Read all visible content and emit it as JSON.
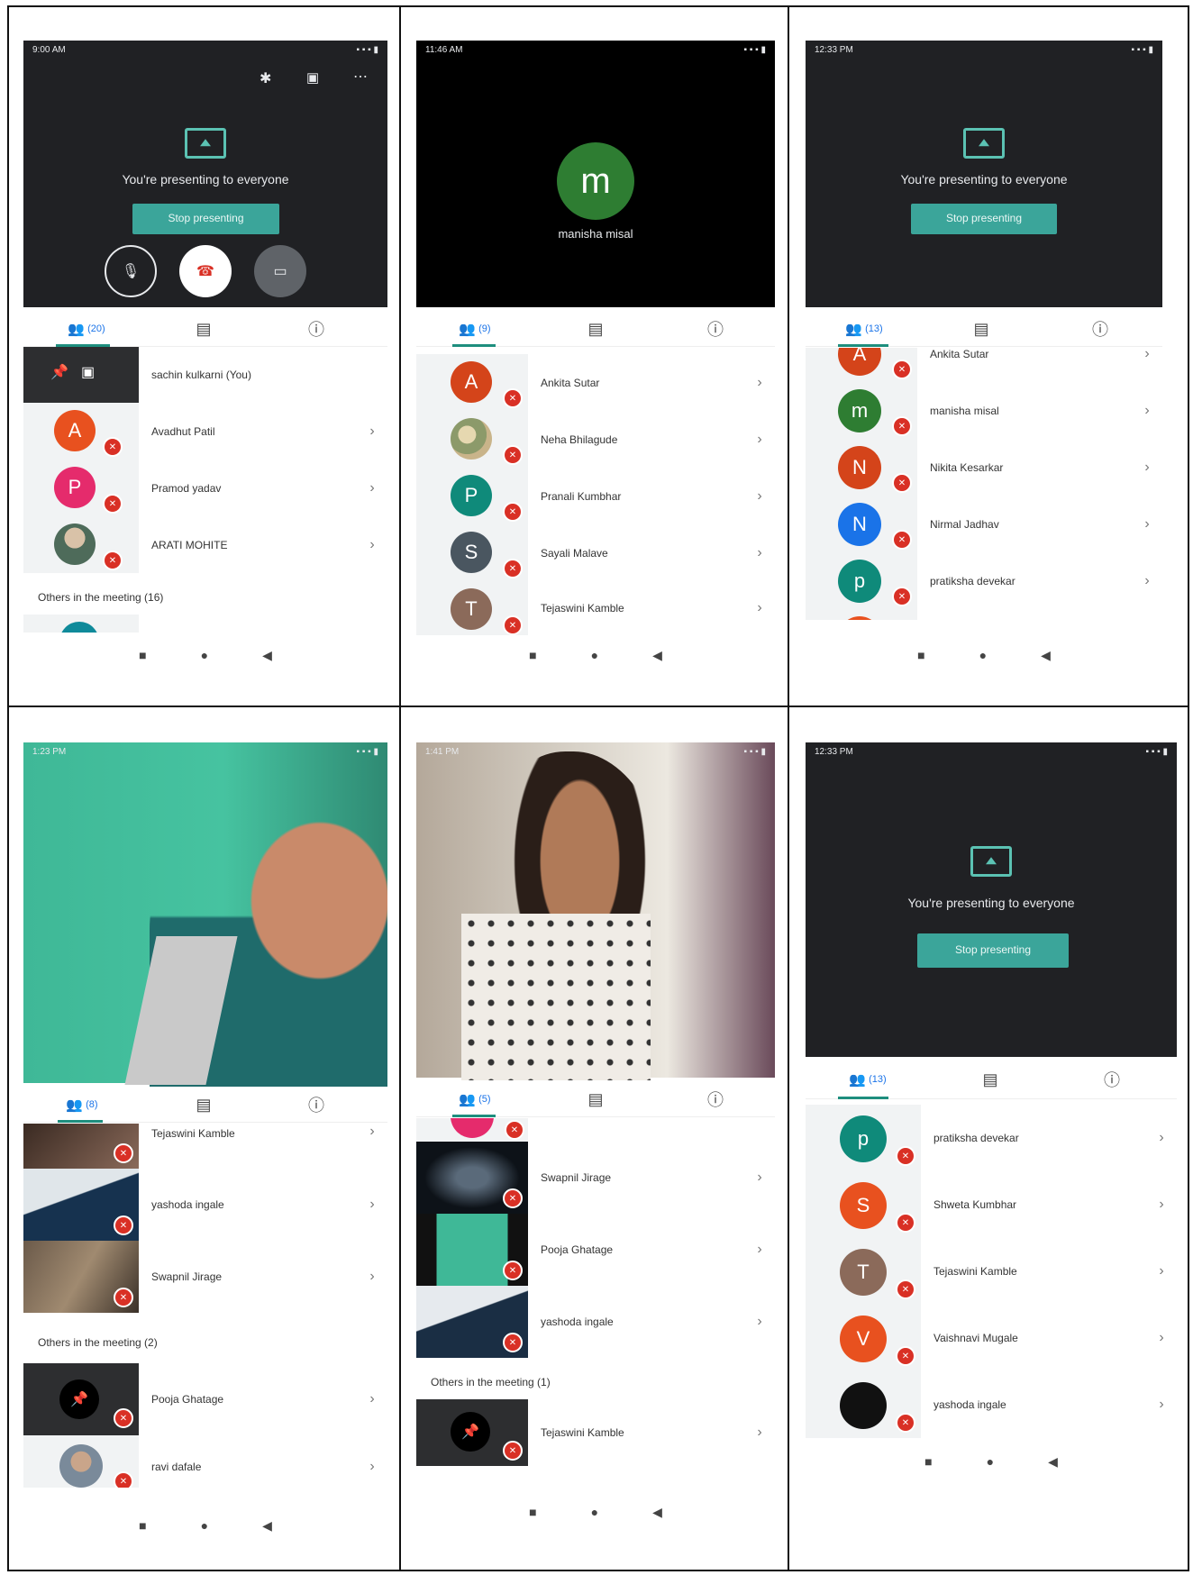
{
  "colors": {
    "teal": "#3ba59a",
    "dark_bg": "#202124",
    "mute_red": "#d93025",
    "tab_blue": "#1a73e8"
  },
  "panel1": {
    "time": "9:00 AM",
    "top_icons": [
      "bluetooth-icon",
      "caption-icon",
      "more-icon"
    ],
    "presenting_text": "You're presenting to everyone",
    "stop_label": "Stop presenting",
    "tab_count": "(20)",
    "self_name": "sachin kulkarni (You)",
    "participants": [
      {
        "letter": "A",
        "name": "Avadhut Patil",
        "color": "#e8511f"
      },
      {
        "letter": "P",
        "name": "Pramod yadav",
        "color": "#e52b6c"
      },
      {
        "letter": "",
        "name": "ARATI MOHITE",
        "color": "#6e8a6b"
      }
    ],
    "others": "Others in the meeting (16)"
  },
  "panel2": {
    "time": "11:46 AM",
    "speaker_letter": "m",
    "speaker_name": "manisha misal",
    "tab_count": "(9)",
    "participants": [
      {
        "letter": "A",
        "name": "Ankita Sutar",
        "color": "#d4441a"
      },
      {
        "letter": "",
        "name": "Neha Bhilagude",
        "color": "#b9a77a"
      },
      {
        "letter": "P",
        "name": "Pranali Kumbhar",
        "color": "#0f8a7a"
      },
      {
        "letter": "S",
        "name": "Sayali Malave",
        "color": "#4a5660"
      },
      {
        "letter": "T",
        "name": "Tejaswini Kamble",
        "color": "#8b6a5a"
      }
    ]
  },
  "panel3": {
    "time": "12:33 PM",
    "presenting_text": "You're presenting to everyone",
    "stop_label": "Stop presenting",
    "tab_count": "(13)",
    "participants": [
      {
        "letter": "A",
        "name": "Ankita Sutar",
        "color": "#d4441a"
      },
      {
        "letter": "m",
        "name": "manisha misal",
        "color": "#2e7d32"
      },
      {
        "letter": "N",
        "name": "Nikita Kesarkar",
        "color": "#d4441a"
      },
      {
        "letter": "N",
        "name": "Nirmal Jadhav",
        "color": "#1a73e8"
      },
      {
        "letter": "p",
        "name": "pratiksha devekar",
        "color": "#0f8a7a"
      }
    ]
  },
  "panel4": {
    "time": "1:23 PM",
    "tab_count": "(8)",
    "participants": [
      {
        "name": "Tejaswini Kamble"
      },
      {
        "name": "yashoda ingale"
      },
      {
        "name": "Swapnil Jirage"
      }
    ],
    "others": "Others in the meeting (2)",
    "others_participants": [
      {
        "name": "Pooja Ghatage"
      },
      {
        "name": "ravi dafale"
      }
    ]
  },
  "panel5": {
    "time": "1:41 PM",
    "tab_count": "(5)",
    "participants": [
      {
        "name": "Swapnil Jirage"
      },
      {
        "name": "Pooja Ghatage"
      },
      {
        "name": "yashoda ingale"
      }
    ],
    "others": "Others in the meeting (1)",
    "others_participants": [
      {
        "name": "Tejaswini Kamble"
      }
    ]
  },
  "panel6": {
    "time": "12:33 PM",
    "presenting_text": "You're presenting to everyone",
    "stop_label": "Stop presenting",
    "tab_count": "(13)",
    "participants": [
      {
        "letter": "p",
        "name": "pratiksha devekar",
        "color": "#0f8a7a"
      },
      {
        "letter": "S",
        "name": "Shweta Kumbhar",
        "color": "#e8511f"
      },
      {
        "letter": "T",
        "name": "Tejaswini Kamble",
        "color": "#8b6a5a"
      },
      {
        "letter": "V",
        "name": "Vaishnavi Mugale",
        "color": "#e8511f"
      },
      {
        "letter": "",
        "name": "yashoda ingale",
        "color": "#111111"
      }
    ]
  }
}
